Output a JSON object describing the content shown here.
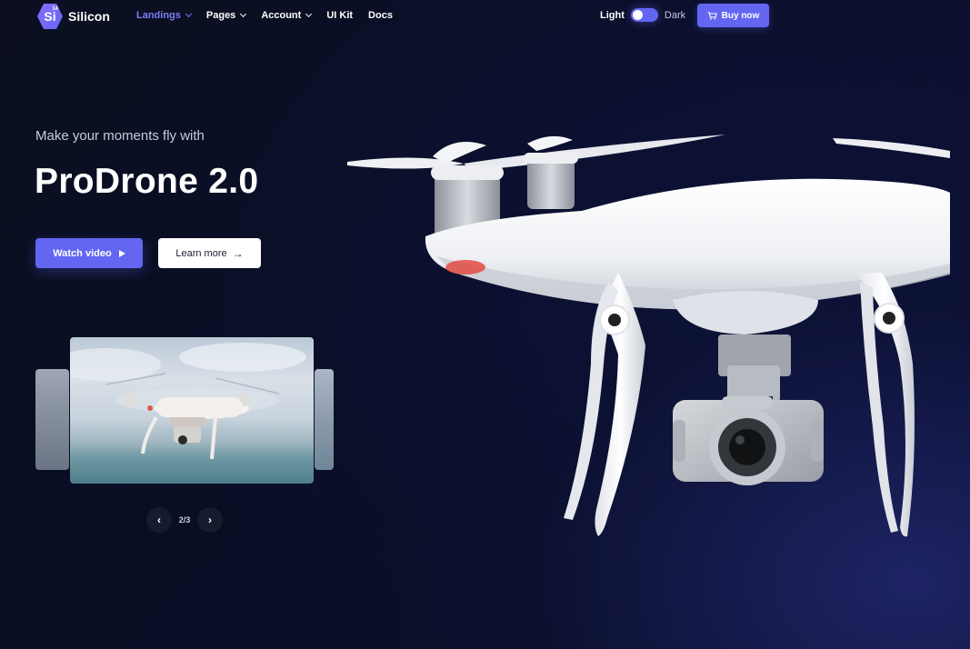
{
  "brand": {
    "name": "Silicon",
    "mark": "Si",
    "mark_sup": "14"
  },
  "nav": [
    {
      "label": "Landings",
      "dropdown": true,
      "active": true
    },
    {
      "label": "Pages",
      "dropdown": true,
      "active": false
    },
    {
      "label": "Account",
      "dropdown": true,
      "active": false
    },
    {
      "label": "UI Kit",
      "dropdown": false,
      "active": false
    },
    {
      "label": "Docs",
      "dropdown": false,
      "active": false
    }
  ],
  "theme_toggle": {
    "light_label": "Light",
    "dark_label": "Dark",
    "state": "dark"
  },
  "buy_button": {
    "label": "Buy now",
    "icon": "cart-icon"
  },
  "hero": {
    "subtitle": "Make your moments fly with",
    "title": "ProDrone 2.0",
    "watch_video_label": "Watch video",
    "learn_more_label": "Learn more"
  },
  "slider": {
    "counter": "2/3",
    "current": 2,
    "total": 3
  },
  "colors": {
    "accent": "#6366f1",
    "active_nav": "#7c7ff5",
    "background": "#0b0f21"
  }
}
